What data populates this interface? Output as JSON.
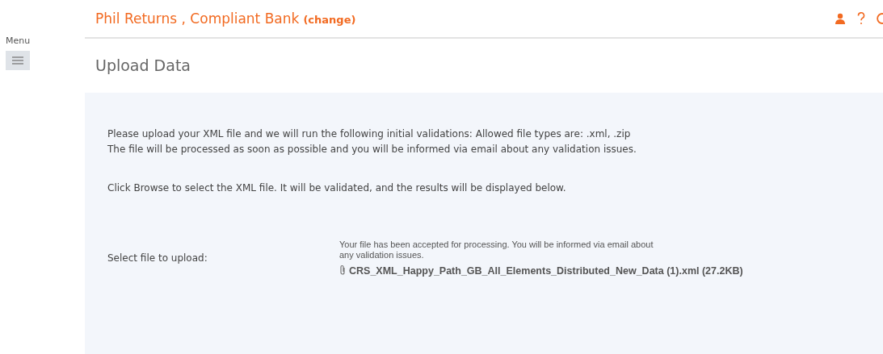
{
  "sidebar": {
    "menu_label": "Menu"
  },
  "header": {
    "title": "Phil Returns , Compliant Bank",
    "change_link": "(change)"
  },
  "page": {
    "title": "Upload Data"
  },
  "panel": {
    "intro_lines": [
      "Please upload your XML file and we will run the following initial validations: Allowed file types are: .xml, .zip",
      "The file will be processed as soon as possible and you will be informed via email about any validation issues."
    ],
    "instruction": "Click Browse to select the XML file. It will be validated, and the results will be displayed below.",
    "upload": {
      "label": "Select file to upload:",
      "message": "Your file has been accepted for processing. You will be informed via email about any validation issues.",
      "file": "CRS_XML_Happy_Path_GB_All_Elements_Distributed_New_Data (1).xml (27.2KB)"
    }
  }
}
